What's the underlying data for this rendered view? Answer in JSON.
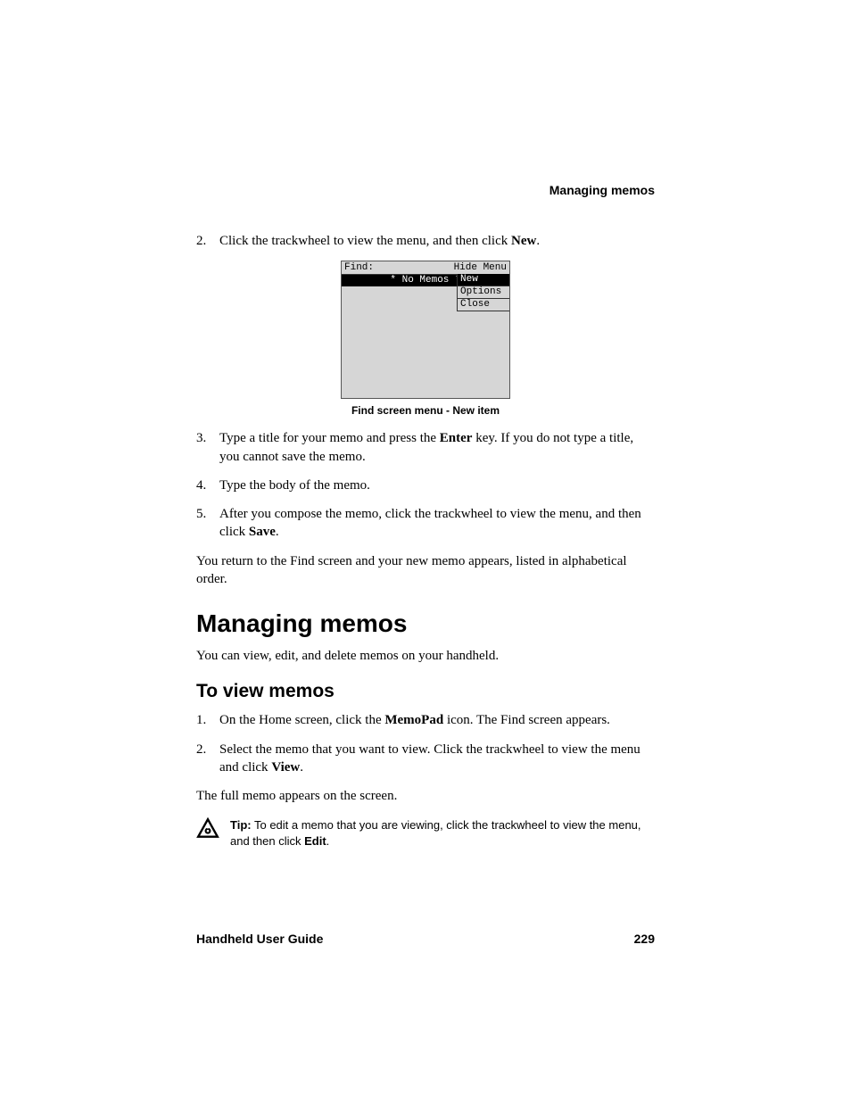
{
  "running_head": "Managing memos",
  "steps_a": [
    {
      "num": "2.",
      "pre": "Click the trackwheel to view the menu, and then click ",
      "bold": "New",
      "post": "."
    }
  ],
  "device": {
    "find_label": "Find:",
    "hide_menu": "Hide Menu",
    "no_memos": "* No Memos *",
    "menu": {
      "new": "New",
      "options": "Options",
      "close": "Close"
    }
  },
  "fig_caption": "Find screen menu - New item",
  "steps_b": [
    {
      "num": "3.",
      "pre": "Type a title for your memo and press the ",
      "bold": "Enter",
      "post": " key. If you do not type a title, you cannot save the memo."
    },
    {
      "num": "4.",
      "pre": "Type the body of the memo.",
      "bold": "",
      "post": ""
    },
    {
      "num": "5.",
      "pre": "After you compose the memo, click the trackwheel to view the menu, and then click ",
      "bold": "Save",
      "post": "."
    }
  ],
  "para_after_steps": "You return to the Find screen and your new memo appears, listed in alphabetical order.",
  "h1": "Managing memos",
  "para_h1": "You can view, edit, and delete memos on your handheld.",
  "h2": "To view memos",
  "steps_c": [
    {
      "num": "1.",
      "pre": "On the Home screen, click the ",
      "bold": "MemoPad",
      "post": " icon. The Find screen appears."
    },
    {
      "num": "2.",
      "pre": "Select the memo that you want to view. Click the trackwheel to view the menu and click ",
      "bold": "View",
      "post": "."
    }
  ],
  "para_h2": "The full memo appears on the screen.",
  "tip": {
    "label": "Tip:",
    "pre": " To edit a memo that you are viewing, click the trackwheel to view the menu, and then click ",
    "bold": "Edit",
    "post": "."
  },
  "footer": {
    "left": "Handheld User Guide",
    "right": "229"
  }
}
